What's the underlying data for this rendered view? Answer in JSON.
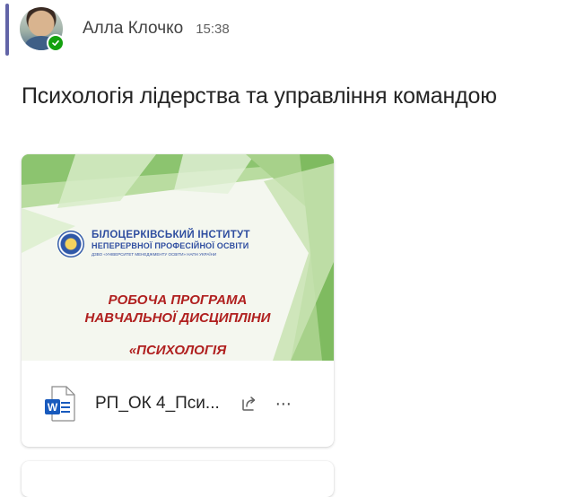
{
  "post": {
    "author": "Алла Клочко",
    "time": "15:38",
    "presence": "available",
    "title": "Психологія лідерства та управління командою"
  },
  "attachment": {
    "file_name": "РП_ОК 4_Пси...",
    "file_type_icon": "word-icon",
    "share_icon": "share-icon",
    "more_icon": "more-options-icon",
    "preview": {
      "institution_line1": "БІЛОЦЕРКІВСЬКИЙ ІНСТИТУТ",
      "institution_line2": "НЕПЕРЕРВНОЇ ПРОФЕСІЙНОЇ ОСВІТИ",
      "institution_line3": "ДЗВО «УНІВЕРСИТЕТ МЕНЕДЖМЕНТУ ОСВІТИ» НАПН УКРАЇНИ",
      "title_line1": "РОБОЧА ПРОГРАМА",
      "title_line2": "НАВЧАЛЬНОЇ ДИСЦИПЛІНИ",
      "title_line3": "«ПСИХОЛОГІЯ"
    }
  },
  "colors": {
    "accent": "#6264a7",
    "presence_green": "#13a10e",
    "word_blue": "#185abd",
    "preview_green": "#8cc46f",
    "doc_title_red": "#b0201f"
  }
}
